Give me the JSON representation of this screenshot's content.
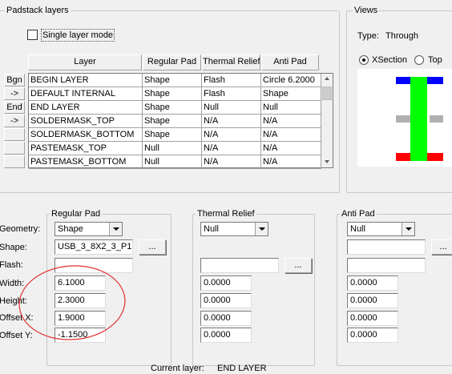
{
  "padstack": {
    "title": "Padstack layers",
    "single_layer_mode": "Single layer mode",
    "columns": [
      "Layer",
      "Regular Pad",
      "Thermal Relief",
      "Anti Pad"
    ],
    "rows": [
      [
        "BEGIN LAYER",
        "Shape",
        "Flash",
        "Circle 6.2000"
      ],
      [
        "DEFAULT INTERNAL",
        "Shape",
        "Flash",
        "Shape"
      ],
      [
        "END LAYER",
        "Shape",
        "Null",
        "Null"
      ],
      [
        "SOLDERMASK_TOP",
        "Shape",
        "N/A",
        "N/A"
      ],
      [
        "SOLDERMASK_BOTTOM",
        "Shape",
        "N/A",
        "N/A"
      ],
      [
        "PASTEMASK_TOP",
        "Null",
        "N/A",
        "N/A"
      ],
      [
        "PASTEMASK_BOTTOM",
        "Null",
        "N/A",
        "N/A"
      ]
    ],
    "row_buttons": [
      "Bgn",
      "->",
      "End",
      "->",
      "",
      "",
      ""
    ]
  },
  "views": {
    "title": "Views",
    "type_label": "Type:",
    "type_value": "Through",
    "xsection": "XSection",
    "top": "Top",
    "selected": "XSection",
    "colors": {
      "top": "#0000ff",
      "inner": "#b0b0b0",
      "bottom": "#ff0000",
      "drill": "#00ff00"
    }
  },
  "labels": {
    "geometry": "Geometry:",
    "shape": "Shape:",
    "flash": "Flash:",
    "width": "Width:",
    "height": "Height:",
    "offset_x": "Offset X:",
    "offset_y": "Offset Y:"
  },
  "regular_pad": {
    "title": "Regular Pad",
    "geometry": "Shape",
    "shape": "USB_3_8X2_3_P1",
    "browse": "...",
    "flash": "",
    "width": "6.1000",
    "height": "2.3000",
    "offset_x": "1.9000",
    "offset_y": "-1.1500"
  },
  "thermal_relief": {
    "title": "Thermal Relief",
    "geometry": "Null",
    "flash": "",
    "browse": "...",
    "width": "0.0000",
    "height": "0.0000",
    "offset_x": "0.0000",
    "offset_y": "0.0000"
  },
  "anti_pad": {
    "title": "Anti Pad",
    "geometry": "Null",
    "shape": "",
    "browse": "...",
    "flash": "",
    "width": "0.0000",
    "height": "0.0000",
    "offset_x": "0.0000",
    "offset_y": "0.0000"
  },
  "footer": {
    "current_layer_label": "Current layer:",
    "current_layer_value": "END LAYER"
  },
  "annotation_color": "#e03030"
}
